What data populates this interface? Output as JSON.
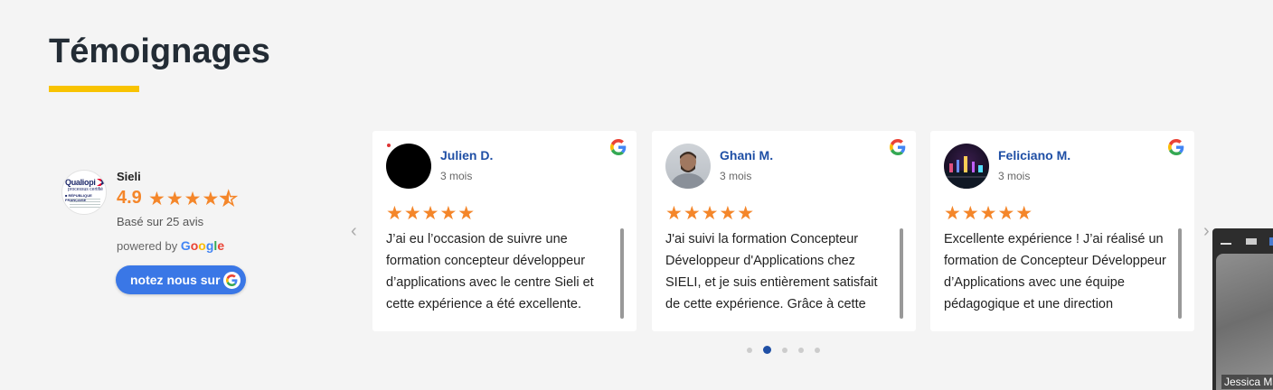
{
  "section": {
    "title": "Témoignages",
    "accent_color": "#f8c301"
  },
  "summary": {
    "business_name": "Sieli",
    "rating": "4.9",
    "stars": "★★★★",
    "half_star": "★",
    "based_on": "Basé sur 25 avis",
    "powered_by": "powered by",
    "google": [
      "G",
      "o",
      "o",
      "g",
      "l",
      "e"
    ],
    "rate_button": "notez nous sur",
    "logo_text": {
      "brand": "Qualiopi",
      "sub": "processus certifié",
      "country": "■ RÉPUBLIQUE FRANÇAISE"
    }
  },
  "carousel": {
    "prev_label": "‹",
    "next_label": "›",
    "active_page": 2,
    "page_count": 5
  },
  "reviews": [
    {
      "author": "Julien D.",
      "time": "3 mois",
      "stars": "★★★★★",
      "text": "J’ai eu l’occasion de suivre une formation concepteur développeur d’applications avec le centre Sieli et cette expérience a été excellente.",
      "avatar": "black-circle"
    },
    {
      "author": "Ghani M.",
      "time": "3 mois",
      "stars": "★★★★★",
      "text": "J'ai suivi la formation Concepteur Développeur d'Applications chez SIELI, et je suis entièrement satisfait de cette expérience. Grâce à cette",
      "avatar": "person-photo"
    },
    {
      "author": "Feliciano M.",
      "time": "3 mois",
      "stars": "★★★★★",
      "text": "Excellente expérience ! J’ai réalisé un formation de Concepteur Développeur d’Applications avec une équipe pédagogique et une direction",
      "avatar": "night-city-photo"
    }
  ],
  "video_overlay": {
    "participant_name": "Jessica Ma"
  },
  "colors": {
    "star": "#f4862a",
    "author": "#1f4fa5",
    "button": "#3a77e6"
  }
}
